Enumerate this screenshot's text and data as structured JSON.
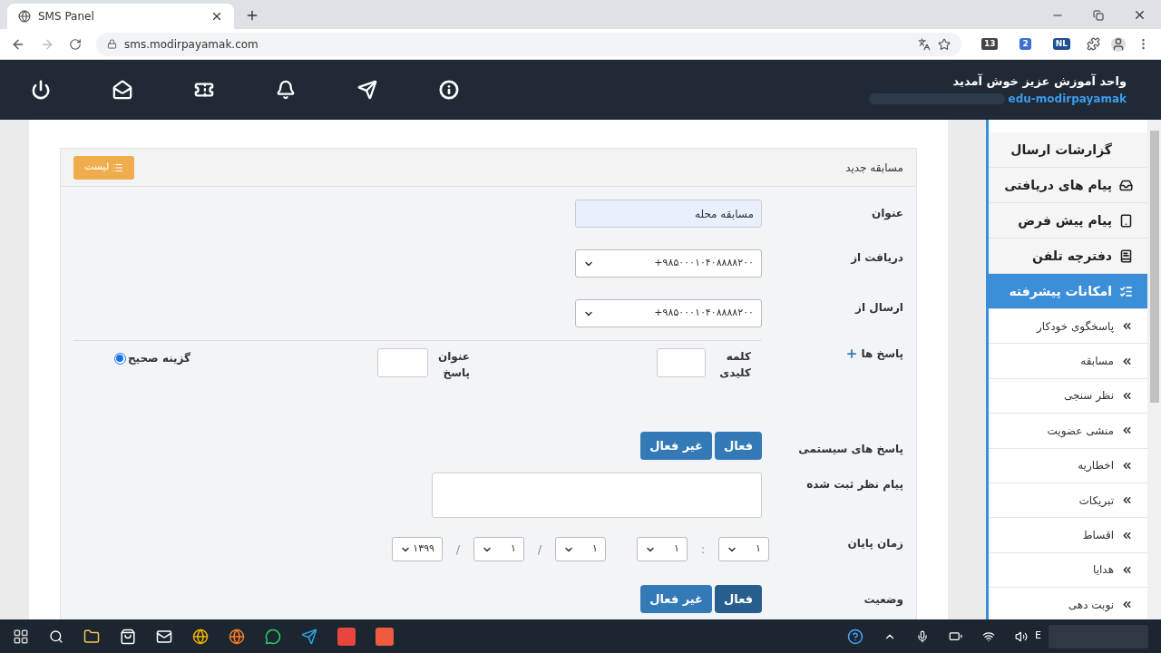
{
  "browser": {
    "tab_title": "SMS Panel",
    "url": "sms.modirpayamak.com",
    "counter_badge": "13",
    "notification_badge": "2",
    "language_badge": "NL"
  },
  "header": {
    "welcome": "واحد آموزش عزیز خوش آمدید",
    "username": "edu-modirpayamak"
  },
  "sidebar": {
    "items": [
      {
        "kind": "main",
        "label": "گزارشات ارسال",
        "selected": false
      },
      {
        "kind": "main",
        "label": "پیام های دریافتی",
        "selected": false
      },
      {
        "kind": "main",
        "label": "پیام پیش فرض",
        "selected": false
      },
      {
        "kind": "main",
        "label": "دفترچه تلفن",
        "selected": false
      },
      {
        "kind": "main",
        "label": "امکانات پیشرفته",
        "selected": true
      },
      {
        "kind": "sub",
        "label": "پاسخگوی خودکار",
        "selected": false
      },
      {
        "kind": "sub",
        "label": "مسابقه",
        "selected": false
      },
      {
        "kind": "sub",
        "label": "نظر سنجی",
        "selected": false
      },
      {
        "kind": "sub",
        "label": "منشی عضویت",
        "selected": false
      },
      {
        "kind": "sub",
        "label": "اخطاریه",
        "selected": false
      },
      {
        "kind": "sub",
        "label": "تبریکات",
        "selected": false
      },
      {
        "kind": "sub",
        "label": "اقساط",
        "selected": false
      },
      {
        "kind": "sub",
        "label": "هدایا",
        "selected": false
      },
      {
        "kind": "sub",
        "label": "نوبت دهی",
        "selected": false
      }
    ]
  },
  "card": {
    "title": "مسابقه جدید",
    "list_button": "لیست",
    "title_field": {
      "label": "عنوان",
      "value": "مسابقه محله"
    },
    "receive_from": {
      "label": "دریافت از",
      "value": "+۹۸۵۰۰۰۱۰۴۰۸۸۸۸۲۰۰"
    },
    "send_from": {
      "label": "ارسال از",
      "value": "+۹۸۵۰۰۰۱۰۴۰۸۸۸۸۲۰۰"
    },
    "answers": {
      "label": "پاسخ ها",
      "keyword_label": "کلمه کلیدی",
      "answer_title_label": "عنوان پاسخ",
      "correct_label": "گزینه صحیح",
      "correct_checked": true
    },
    "system_replies": {
      "label": "پاسخ های سیستمی",
      "options": [
        {
          "label": "فعال",
          "selected": false
        },
        {
          "label": "غیر فعال",
          "selected": false
        }
      ]
    },
    "registered_message": {
      "label": "پیام نظر ثبت شده"
    },
    "end_time": {
      "label": "زمان پایان",
      "parts": [
        {
          "kind": "select",
          "value": "۱"
        },
        {
          "kind": "separator",
          "value": ":"
        },
        {
          "kind": "select",
          "value": "۱"
        },
        {
          "kind": "gap"
        },
        {
          "kind": "select",
          "value": "۱"
        },
        {
          "kind": "separator",
          "value": "/"
        },
        {
          "kind": "select",
          "value": "۱"
        },
        {
          "kind": "separator",
          "value": "/"
        },
        {
          "kind": "select",
          "value": "۱۳۹۹"
        }
      ]
    },
    "status": {
      "label": "وضعیت",
      "options": [
        {
          "label": "فعال",
          "selected": true
        },
        {
          "label": "غیر فعال",
          "selected": false
        }
      ]
    }
  },
  "taskbar": {
    "language": "E"
  }
}
